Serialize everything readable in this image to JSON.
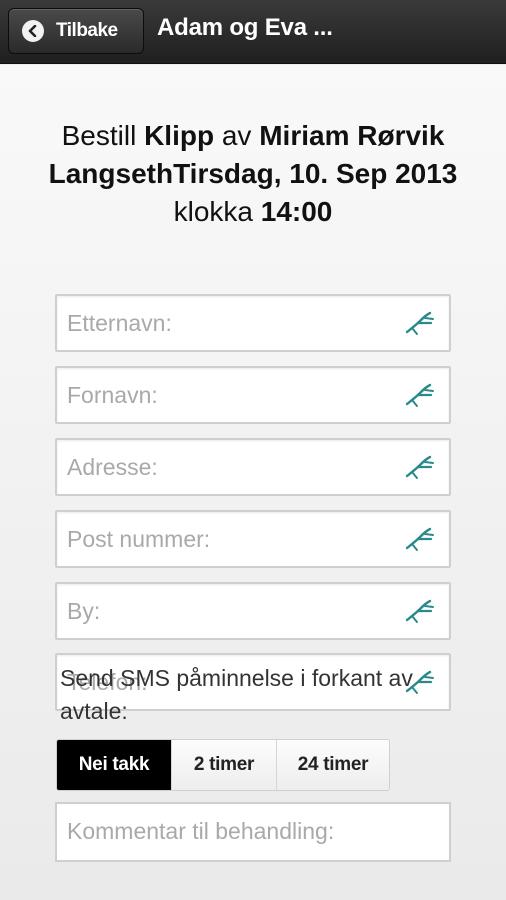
{
  "header": {
    "back_label": "Tilbake",
    "title": "Adam og Eva ..."
  },
  "booking": {
    "prefix": "Bestill ",
    "service": "Klipp",
    "by": " av ",
    "staff_and_date": "Miriam Rørvik LangsethTirsdag, 10. Sep 2013",
    "time_prefix": "klokka ",
    "time": "14:00"
  },
  "form": {
    "fields": [
      {
        "placeholder": "Etternavn:",
        "icon": "arrow-pen-icon"
      },
      {
        "placeholder": "Fornavn:",
        "icon": "arrow-pen-icon"
      },
      {
        "placeholder": "Adresse:",
        "icon": "arrow-pen-icon"
      },
      {
        "placeholder": "Post nummer:",
        "icon": "arrow-pen-icon"
      },
      {
        "placeholder": "By:",
        "icon": "arrow-pen-icon"
      },
      {
        "placeholder": "Telefon:",
        "icon": "arrow-pen-icon"
      }
    ],
    "sms_label": "Send SMS påminnelse i forkant av avtale:",
    "sms_options": [
      "Nei takk",
      "2 timer",
      "24 timer"
    ],
    "sms_selected": "Nei takk",
    "comment_placeholder": "Kommentar til behandling:"
  },
  "colors": {
    "header_bg": "#2a2a2a",
    "icon_teal": "#2a8a8a",
    "selected_segment": "#000000"
  }
}
